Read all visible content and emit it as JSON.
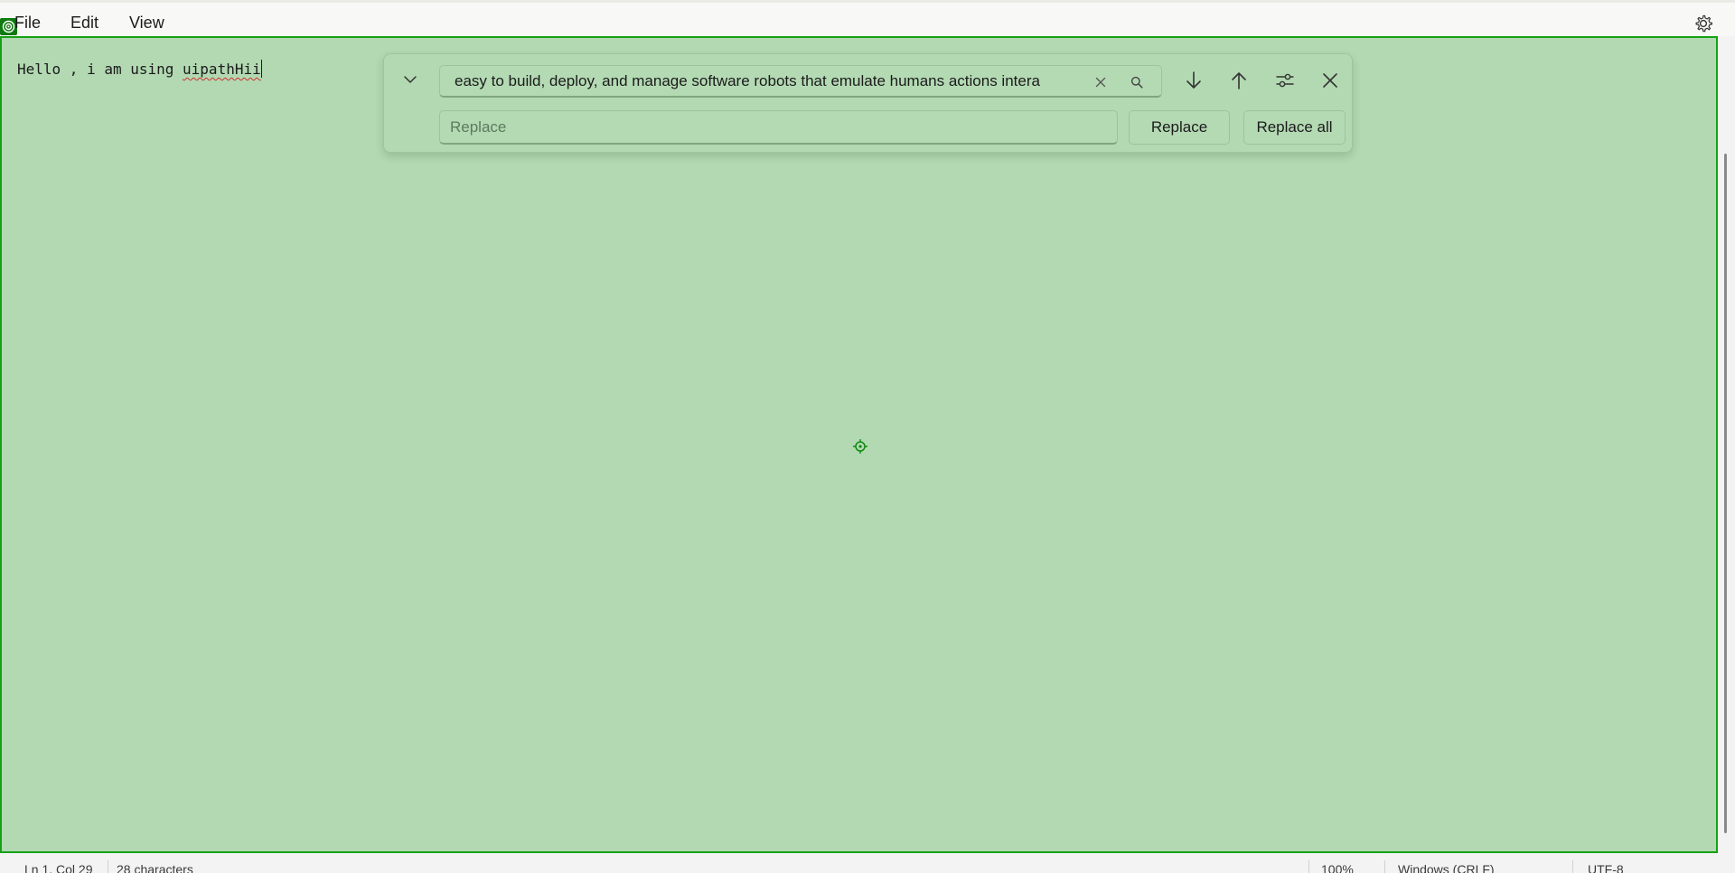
{
  "menubar": {
    "items": [
      "File",
      "Edit",
      "View"
    ]
  },
  "icons": {
    "app": "target-icon",
    "settings": "gear-icon",
    "toggle": "chevron-down-icon",
    "clear": "close-icon",
    "search": "search-icon",
    "next": "arrow-down-icon",
    "previous": "arrow-up-icon",
    "options": "sliders-icon",
    "close": "close-icon",
    "cursor": "crosshair-icon"
  },
  "editor": {
    "text_prefix": "Hello , i am using ",
    "text_misspelled": "uipathHii"
  },
  "find": {
    "value": "easy to build, deploy, and manage software robots that emulate humans actions intera"
  },
  "replace": {
    "placeholder": "Replace",
    "replace_label": "Replace",
    "replace_all_label": "Replace all"
  },
  "status": {
    "position": "Ln 1, Col 29",
    "characters": "28 characters",
    "zoom": "100%",
    "line_ending": "Windows (CRLF)",
    "encoding": "UTF-8"
  },
  "colors": {
    "editor_bg": "#b2d9b2",
    "editor_border": "#16a016",
    "accent": "#0f7a0f"
  }
}
